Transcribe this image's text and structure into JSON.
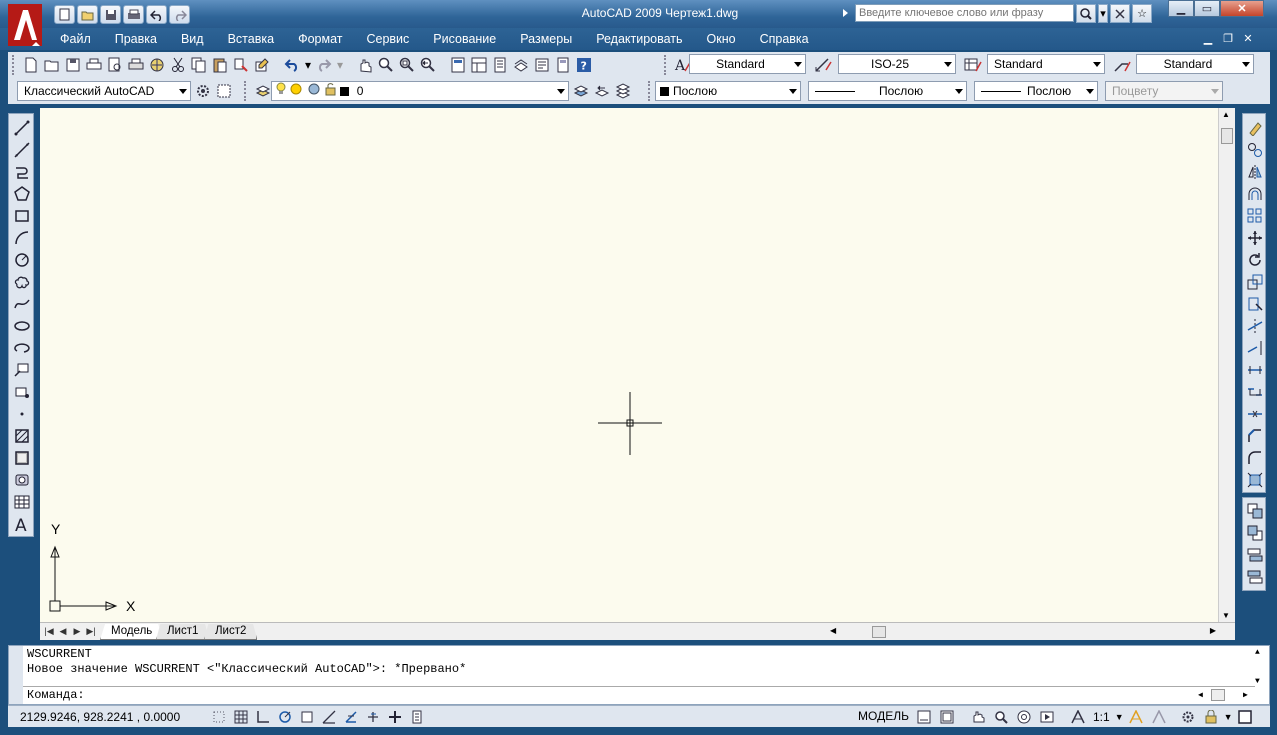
{
  "window": {
    "title": "AutoCAD 2009 Чертеж1.dwg",
    "search_placeholder": "Введите ключевое слово или фразу"
  },
  "menu": [
    "Файл",
    "Правка",
    "Вид",
    "Вставка",
    "Формат",
    "Сервис",
    "Рисование",
    "Размеры",
    "Редактировать",
    "Окно",
    "Справка"
  ],
  "styles": {
    "text_style": "Standard",
    "dim_style": "ISO-25",
    "table_style": "Standard",
    "multileader_style": "Standard"
  },
  "workspace": "Классический AutoCAD",
  "layer": "0",
  "properties": {
    "color": "Послою",
    "linetype": "Послою",
    "lineweight": "Послою",
    "plotstyle": "Поцвету"
  },
  "ucs": {
    "x_label": "X",
    "y_label": "Y"
  },
  "layout_tabs": [
    "Модель",
    "Лист1",
    "Лист2"
  ],
  "command": {
    "history_line1": "WSCURRENT",
    "history_line2": "Новое значение WSCURRENT <\"Классический AutoCAD\">: *Прервано*",
    "prompt": "Команда:"
  },
  "status": {
    "coordinates": "2129.9246, 928.2241 , 0.0000",
    "space": "МОДЕЛЬ",
    "annotation_scale": "1:1"
  },
  "colors": {
    "titlebar": "#2f6598",
    "canvas": "#fcfbee",
    "toolbar": "#dfe6ef",
    "logo_red": "#c8201c"
  }
}
